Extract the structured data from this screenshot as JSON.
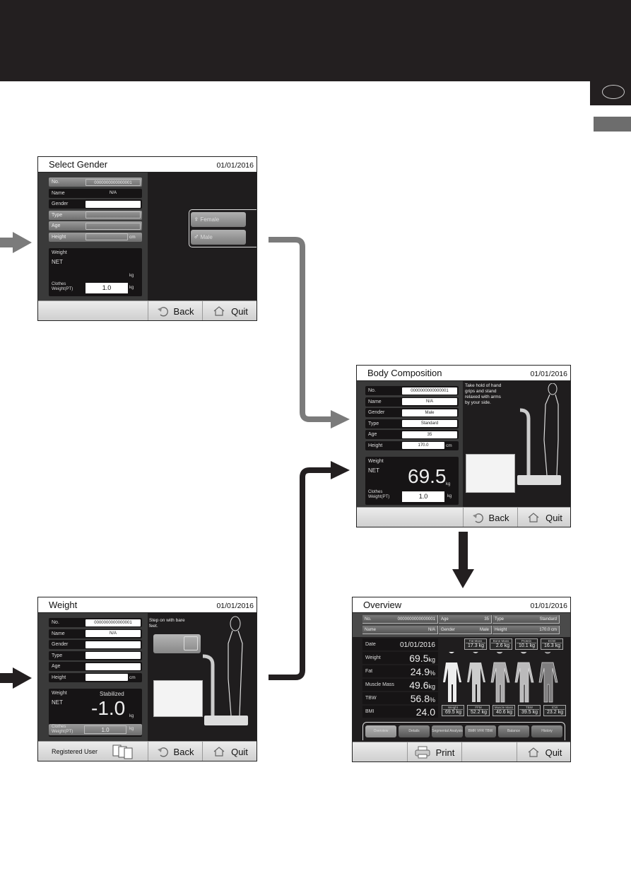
{
  "colors": {
    "band": "#231f20",
    "gray_arrow": "#7b7b7b",
    "black_arrow": "#231f20"
  },
  "select_gender": {
    "title": "Select Gender",
    "date": "01/01/2016",
    "rows": [
      {
        "label": "No.",
        "value": "0000000000000001",
        "style": "gray"
      },
      {
        "label": "Name",
        "value": "N/A",
        "style": "nobox"
      },
      {
        "label": "Gender",
        "value": "",
        "style": "dark"
      },
      {
        "label": "Type",
        "value": "",
        "style": "gray"
      },
      {
        "label": "Age",
        "value": "",
        "style": "gray"
      },
      {
        "label": "Height",
        "value": "",
        "unit": "cm",
        "style": "gray"
      }
    ],
    "weight_label": "Weight",
    "net_label": "NET",
    "weight_unit": "kg",
    "clothes_label": "Clothes Weight(PT)",
    "clothes_value": "1.0",
    "clothes_unit": "kg",
    "female_label": "Female",
    "male_label": "Male",
    "back_label": "Back",
    "quit_label": "Quit"
  },
  "body_composition": {
    "title": "Body Composition",
    "date": "01/01/2016",
    "rows": [
      {
        "label": "No.",
        "value": "0000000000000001",
        "style": "dark"
      },
      {
        "label": "Name",
        "value": "N/A",
        "style": "dark"
      },
      {
        "label": "Gender",
        "value": "Male",
        "style": "dark"
      },
      {
        "label": "Type",
        "value": "Standard",
        "style": "dark"
      },
      {
        "label": "Age",
        "value": "35",
        "style": "dark"
      },
      {
        "label": "Height",
        "value": "170.0",
        "unit": "cm",
        "style": "dark"
      }
    ],
    "instruction": "Take hold of hand grips and stand relaxed with arms by your side.",
    "weight_label": "Weight",
    "net_label": "NET",
    "weight_value": "69.5",
    "weight_unit": "kg",
    "clothes_label": "Clothes Weight(PT)",
    "clothes_value": "1.0",
    "clothes_unit": "kg",
    "back_label": "Back",
    "quit_label": "Quit"
  },
  "weight": {
    "title": "Weight",
    "date": "01/01/2016",
    "rows": [
      {
        "label": "No.",
        "value": "0000000000000001",
        "style": "dark"
      },
      {
        "label": "Name",
        "value": "N/A",
        "style": "dark"
      },
      {
        "label": "Gender",
        "value": "",
        "style": "dark"
      },
      {
        "label": "Type",
        "value": "",
        "style": "dark"
      },
      {
        "label": "Age",
        "value": "",
        "style": "dark"
      },
      {
        "label": "Height",
        "value": "",
        "unit": "cm",
        "style": "dark"
      }
    ],
    "instruction": "Step on with bare feet.",
    "weight_label": "Weight",
    "status": "Stabilized",
    "net_label": "NET",
    "weight_value": "-1.0",
    "weight_unit": "kg",
    "clothes_label": "Clothes Weight(PT)",
    "clothes_value": "1.0",
    "clothes_unit": "kg",
    "registered_user_label": "Registered User",
    "back_label": "Back",
    "quit_label": "Quit"
  },
  "overview": {
    "title": "Overview",
    "date": "01/01/2016",
    "header": [
      [
        {
          "label": "No.",
          "value": "0000000000000001"
        },
        {
          "label": "Age",
          "value": "35"
        },
        {
          "label": "Type",
          "value": "Standard"
        }
      ],
      [
        {
          "label": "Name",
          "value": "N/A"
        },
        {
          "label": "Gender",
          "value": "Male"
        },
        {
          "label": "Height",
          "value": "170.0   cm"
        }
      ]
    ],
    "date_label": "Date",
    "date_value": "01/01/2016",
    "results": [
      {
        "label": "Weight",
        "value": "69.5",
        "unit": "kg"
      },
      {
        "label": "Fat",
        "value": "24.9",
        "unit": "%"
      },
      {
        "label": "Muscle Mass",
        "value": "49.6",
        "unit": "kg"
      },
      {
        "label": "TBW",
        "value": "56.8",
        "unit": "%"
      },
      {
        "label": "BMI",
        "value": "24.0",
        "unit": ""
      }
    ],
    "top_minis": [
      {
        "label": "Fat Mass",
        "value": "17.3 kg"
      },
      {
        "label": "Bone Mass",
        "value": "2.6 kg"
      },
      {
        "label": "Protein",
        "value": "10.1 kg"
      },
      {
        "label": "ECW",
        "value": "16.3 kg"
      }
    ],
    "bottom_minis": [
      {
        "label": "Weight",
        "value": "69.5 kg"
      },
      {
        "label": "FFM",
        "value": "52.2 kg"
      },
      {
        "label": "Muscle Mass",
        "value": "40.6 kg"
      },
      {
        "label": "TBW",
        "value": "39.5 kg"
      },
      {
        "label": "ICW",
        "value": "23.2 kg"
      }
    ],
    "tabs": [
      "Overview",
      "Details",
      "Segmental Analysis",
      "BMR VFR TBW",
      "Balance",
      "History"
    ],
    "active_tab": "Overview",
    "print_label": "Print",
    "quit_label": "Quit"
  }
}
